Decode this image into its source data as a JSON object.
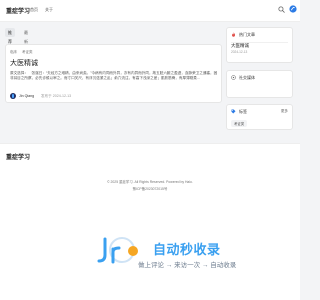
{
  "header": {
    "brand": "重症学习",
    "nav": [
      "首页",
      "关于"
    ]
  },
  "tabs": [
    "推荐",
    "最新"
  ],
  "post": {
    "categories": [
      "临床",
      "考证类"
    ],
    "title": "大医精诚",
    "excerpt": "原文选择：　张湛曰：“夫经方之难精，由来尚矣。”今病有内同而外异，亦有内异而外同，故五脏六腑之盈虚，血脉荣卫之通塞，固非耳目之所察，必先诊候以审之。而寸口关尺，有浮沉弦紧之乱；俞穴流注，有高下浅深之差；肌肤筋骨，有厚薄刚柔…",
    "author": "Jin Qiang",
    "date_prefix": "发布于",
    "date": "2024-12-13"
  },
  "sidebar": {
    "hot": {
      "title": "热门文章",
      "item_title": "大医精诚",
      "item_date": "2024-12-13"
    },
    "social": {
      "title": "社交媒体"
    },
    "tags": {
      "title": "标签",
      "more": "更多",
      "items": [
        "考证类"
      ]
    }
  },
  "footer": {
    "brand": "重症学习",
    "copyright": "© 2025 重症学习. All Rights Reserved. Powered by Halo.",
    "icp": "豫ICP备2023072015号"
  },
  "watermark": {
    "text": "自动秒收录",
    "subtitle": "做上评论 → 来访一次 → 自动收录"
  },
  "colors": {
    "accent": "#3aa0f0",
    "hot_icon": "#e0504b",
    "tag_icon": "#2c7be5"
  }
}
